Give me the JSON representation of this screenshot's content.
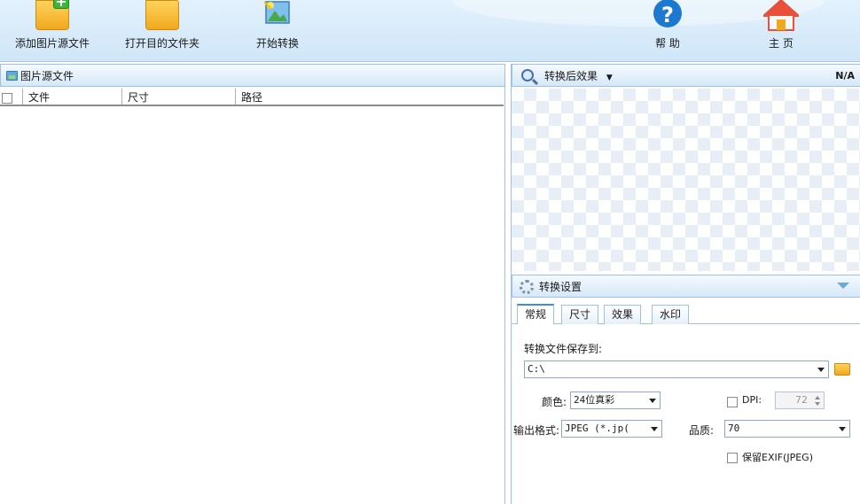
{
  "toolbar": {
    "add_source": "添加图片源文件",
    "open_target": "打开目的文件夹",
    "start": "开始转换",
    "help": "帮 助",
    "home": "主 页"
  },
  "left_panel": {
    "title": "图片源文件",
    "columns": [
      "文件",
      "尺寸",
      "路径"
    ]
  },
  "preview": {
    "title": "转换后效果",
    "status": "N/A"
  },
  "settings": {
    "title": "转换设置",
    "tabs": [
      "常规",
      "尺寸",
      "效果",
      "水印"
    ],
    "save_to_label": "转换文件保存到:",
    "save_to_value": "C:\\",
    "color_label": "颜色:",
    "color_value": "24位真彩",
    "dpi_label": "DPI:",
    "dpi_value": "72",
    "format_label": "输出格式:",
    "format_value": "JPEG (*.jp(",
    "quality_label": "品质:",
    "quality_value": "70",
    "exif_label": "保留EXIF(JPEG)"
  },
  "colors": {
    "accent": "#3a8fd8",
    "toolbar_bg": "#d6e9f8",
    "folder": "#f0a81e",
    "help_blue": "#1d78d0",
    "home_red": "#e8503a"
  }
}
